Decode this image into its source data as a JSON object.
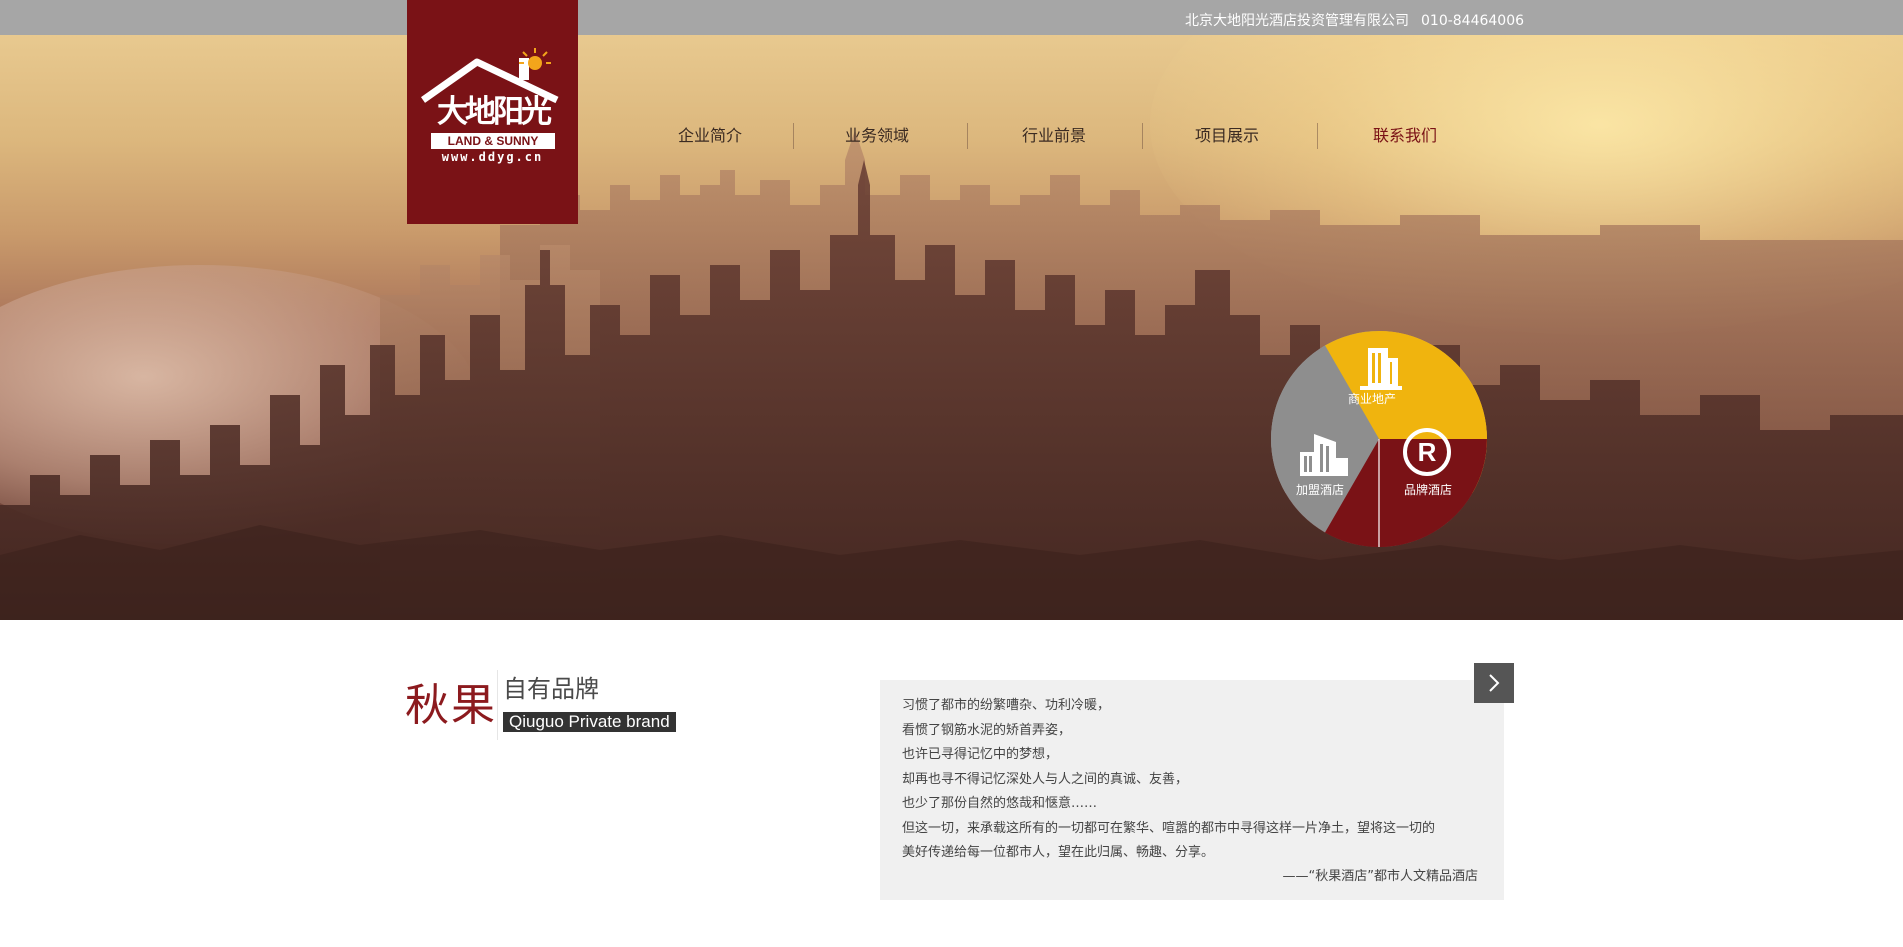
{
  "topbar": {
    "company": "北京大地阳光酒店投资管理有限公司",
    "phone": "010-84464006"
  },
  "logo": {
    "chinese": "大地阳光",
    "english": "LAND & SUNNY",
    "url": "www.ddyg.cn"
  },
  "nav": {
    "items": [
      {
        "label": "企业简介",
        "active": false
      },
      {
        "label": "业务领域",
        "active": false
      },
      {
        "label": "行业前景",
        "active": false
      },
      {
        "label": "项目展示",
        "active": false
      },
      {
        "label": "联系我们",
        "active": true
      }
    ]
  },
  "business_circle": {
    "segments": [
      {
        "label": "商业地产",
        "color": "#f0b40e",
        "icon": "building-icon"
      },
      {
        "label": "品牌酒店",
        "color": "#7a1216",
        "icon": "registered-trademark-icon"
      },
      {
        "label": "加盟酒店",
        "color": "#8e8e8e",
        "icon": "city-buildings-icon"
      }
    ]
  },
  "brand": {
    "name": "秋果",
    "title": "自有品牌",
    "english": "Qiuguo Private brand"
  },
  "quote": {
    "lines": [
      "习惯了都市的纷繁嘈杂、功利冷暖，",
      "看惯了钢筋水泥的矫首弄姿，",
      "也许已寻得记忆中的梦想，",
      "却再也寻不得记忆深处人与人之间的真诚、友善，",
      "也少了那份自然的悠哉和惬意……",
      "但这一切，来承载这所有的一切都可在繁华、喧嚣的都市中寻得这样一片净土，望将这一切的",
      "美好传递给每一位都市人，望在此归属、畅趣、分享。"
    ],
    "signature": "——“秋果酒店”都市人文精品酒店"
  },
  "colors": {
    "brand_red": "#7a1216",
    "top_bar": "#a6a6a6",
    "accent_yellow": "#f0b40e"
  },
  "icons": {
    "next": "chevron-right-icon",
    "sun": "sun-icon",
    "house": "house-roof-icon"
  }
}
